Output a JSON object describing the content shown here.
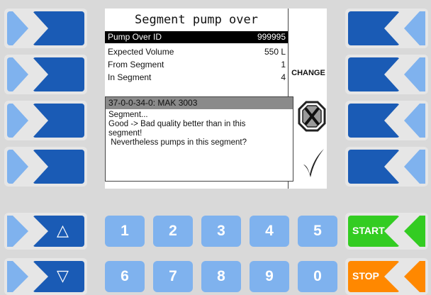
{
  "screen": {
    "title": "Segment pump over",
    "rows": [
      {
        "label": "Pump Over ID",
        "value": "999995"
      },
      {
        "label": "Expected Volume",
        "value": "550 L"
      },
      {
        "label": "From Segment",
        "value": "1"
      },
      {
        "label": "In Segment",
        "value": "4"
      }
    ],
    "change_label": "CHANGE",
    "message": {
      "header": "37-0-0-34-0: MAK 3003",
      "body": "Segment...\nGood -> Bad quality better than in this\nsegment!\n Nevertheless pumps in this segment?"
    }
  },
  "keypad": {
    "row1": [
      "1",
      "2",
      "3",
      "4",
      "5"
    ],
    "row2": [
      "6",
      "7",
      "8",
      "9",
      "0"
    ],
    "up_glyph": "△",
    "down_glyph": "▽"
  },
  "actions": {
    "start_label": "START",
    "stop_label": "STOP"
  },
  "colors": {
    "softkey_blue": "#1a5bb5",
    "softkey_light": "#7fb2ee",
    "start_green": "#33cc22",
    "stop_orange": "#ff8800"
  }
}
